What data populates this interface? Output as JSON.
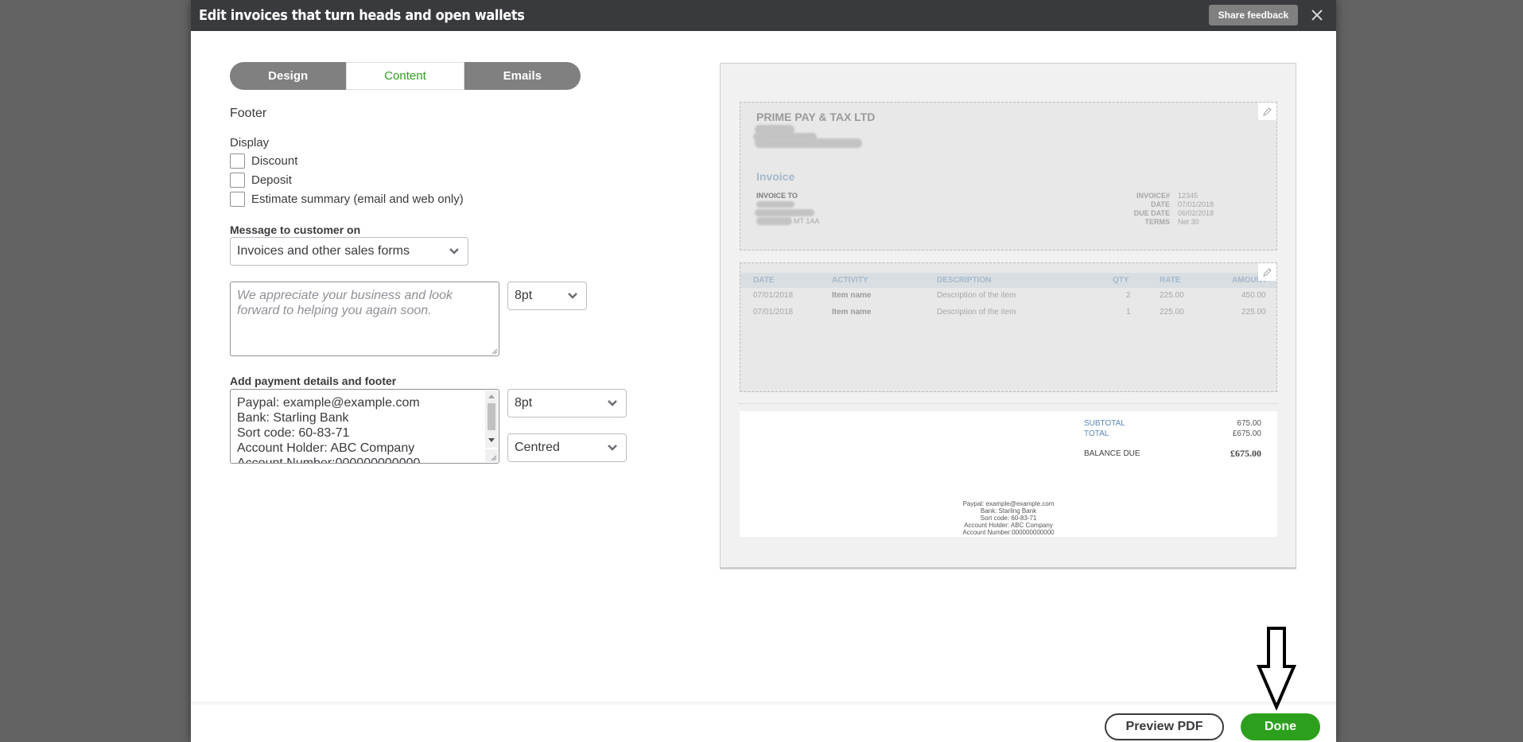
{
  "modal": {
    "title": "Edit invoices that turn heads and open wallets",
    "share_feedback_label": "Share feedback",
    "close_icon": "close-icon"
  },
  "tabs": [
    {
      "label": "Design",
      "active": false
    },
    {
      "label": "Content",
      "active": true
    },
    {
      "label": "Emails",
      "active": false
    }
  ],
  "form": {
    "section_title": "Footer",
    "display_label": "Display",
    "checkboxes": [
      {
        "label": "Discount",
        "checked": false
      },
      {
        "label": "Deposit",
        "checked": false
      },
      {
        "label": "Estimate summary (email and web only)",
        "checked": false
      }
    ],
    "message_label": "Message to customer on",
    "message_on_value": "Invoices and other sales forms",
    "message_placeholder_line1": "We appreciate your business and look",
    "message_placeholder_line2": "forward to helping you again soon.",
    "message_font_size": "8pt",
    "payment_label": "Add payment details and footer",
    "payment_lines": [
      "Paypal: example@example.com",
      "Bank: Starling Bank",
      "Sort code: 60-83-71",
      "Account Holder: ABC Company",
      "Account Number:000000000000"
    ],
    "payment_font_size": "8pt",
    "payment_alignment": "Centred"
  },
  "preview": {
    "company_name": "PRIME PAY & TAX LTD",
    "doc_title": "Invoice",
    "invoice_to_label": "INVOICE TO",
    "address_visible_fragment": "MT 1AA",
    "meta": [
      {
        "label": "INVOICE#",
        "value": "12345"
      },
      {
        "label": "DATE",
        "value": "07/01/2018"
      },
      {
        "label": "DUE DATE",
        "value": "06/02/2018"
      },
      {
        "label": "TERMS",
        "value": "Net 30"
      }
    ],
    "columns": [
      "DATE",
      "ACTIVITY",
      "DESCRIPTION",
      "QTY",
      "RATE",
      "AMOUNT"
    ],
    "rows": [
      {
        "date": "07/01/2018",
        "activity": "Item name",
        "description": "Description of the item",
        "qty": "2",
        "rate": "225.00",
        "amount": "450.00"
      },
      {
        "date": "07/01/2018",
        "activity": "Item name",
        "description": "Description of the item",
        "qty": "1",
        "rate": "225.00",
        "amount": "225.00"
      }
    ],
    "subtotal_label": "SUBTOTAL",
    "subtotal_value": "675.00",
    "total_label": "TOTAL",
    "total_value": "£675.00",
    "balance_label": "BALANCE DUE",
    "balance_value": "£675.00",
    "footer_lines": [
      "Paypal: example@example.com",
      "Bank: Starling Bank",
      "Sort code: 60-83-71",
      "Account Holder: ABC Company",
      "Account Number:000000000000"
    ],
    "accent_color": "#a3b9cc"
  },
  "footer": {
    "preview_pdf_label": "Preview PDF",
    "done_label": "Done"
  },
  "colors": {
    "brand_green": "#2ca01c",
    "titlebar": "#393a3d",
    "tab_inactive": "#808080"
  }
}
